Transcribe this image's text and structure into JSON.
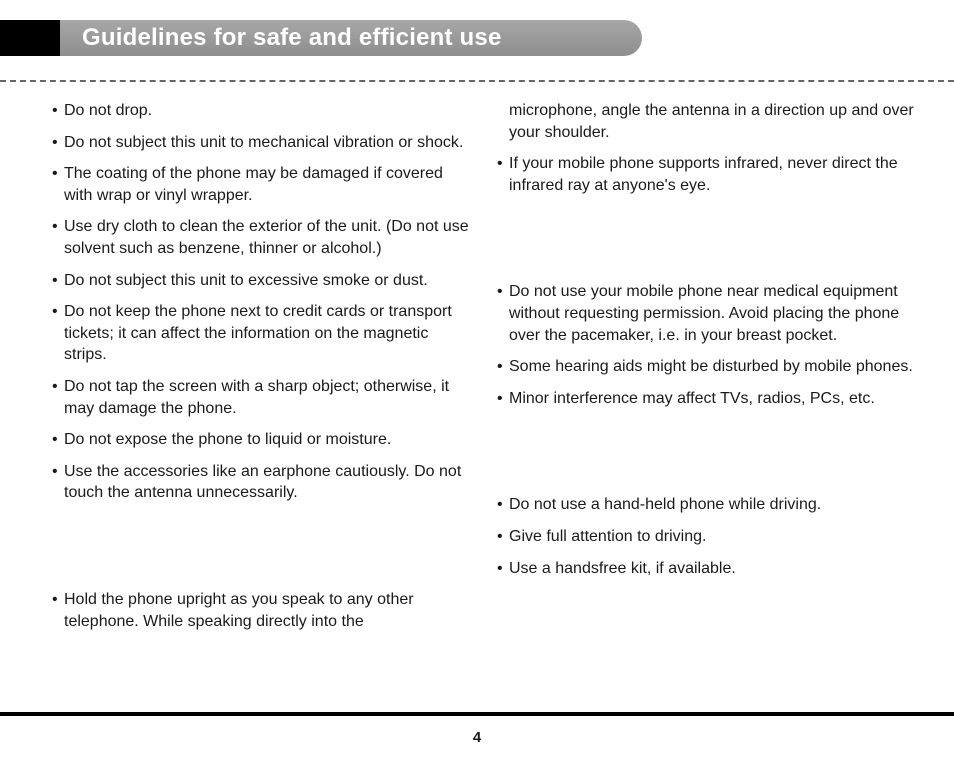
{
  "header": {
    "title": "Guidelines for safe and efficient use"
  },
  "pageNumber": "4",
  "leftColumn": {
    "group1": [
      "Do not drop.",
      "Do not subject this unit to mechanical vibration or shock.",
      "The coating of the phone may be damaged if covered with wrap or vinyl wrapper.",
      "Use dry cloth to clean the exterior of the unit. (Do not use solvent such as benzene, thinner or alcohol.)",
      "Do not subject this unit to excessive smoke or dust.",
      "Do not keep the phone next to credit cards or transport tickets; it can affect the information on the magnetic strips.",
      "Do not tap the screen with a sharp object; otherwise, it may damage the phone.",
      "Do not expose the phone to liquid or moisture.",
      "Use the accessories like an earphone cautiously. Do not touch the antenna unnecessarily."
    ],
    "group2": [
      "Hold the phone upright as you speak to any other telephone. While speaking directly into the"
    ]
  },
  "rightColumn": {
    "continuation": "microphone, angle the antenna in a direction up and over your shoulder.",
    "group1": [
      "If your mobile phone supports infrared, never direct the infrared ray at anyone's eye."
    ],
    "group2": [
      "Do not use your mobile phone near medical equipment without requesting permission. Avoid placing the phone over the pacemaker, i.e. in your breast pocket.",
      "Some hearing aids might be disturbed by mobile phones.",
      "Minor interference may affect TVs, radios, PCs, etc."
    ],
    "group3": [
      "Do not use a hand-held phone while driving.",
      "Give full attention to driving.",
      "Use a handsfree kit, if available."
    ]
  }
}
